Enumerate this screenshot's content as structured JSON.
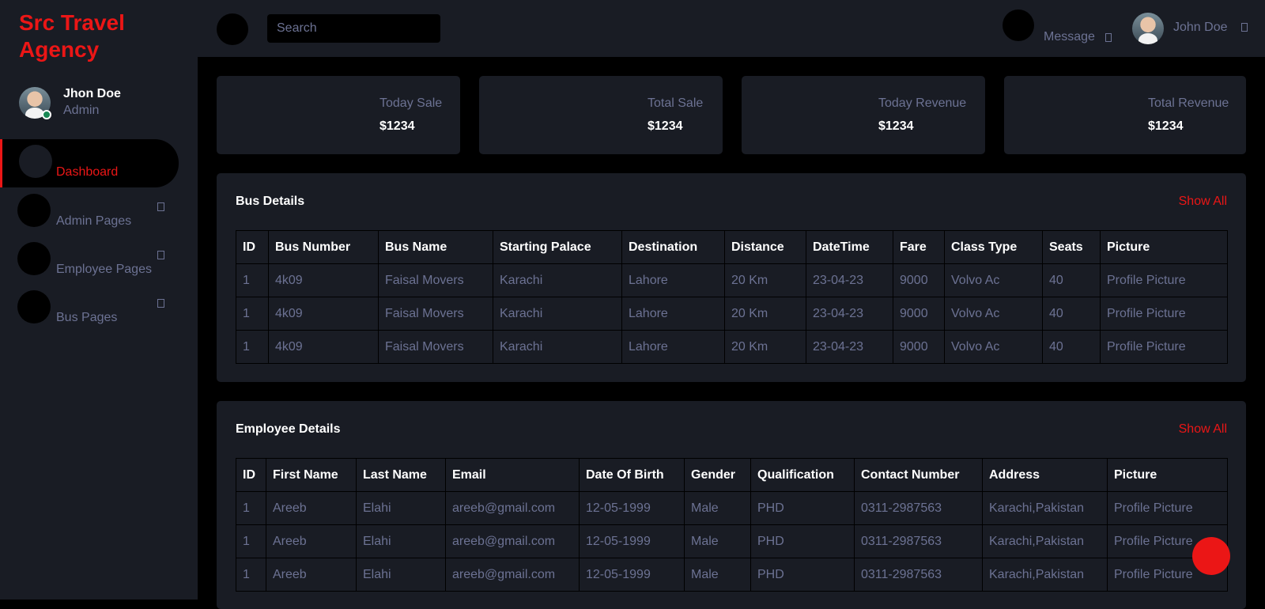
{
  "brand": "Src Travel Agency",
  "sidebar": {
    "user_name": "Jhon Doe",
    "user_role": "Admin",
    "items": [
      {
        "label": "Dashboard"
      },
      {
        "label": "Admin Pages"
      },
      {
        "label": "Employee Pages"
      },
      {
        "label": "Bus Pages"
      }
    ]
  },
  "topbar": {
    "search_placeholder": "Search",
    "message_label": "Message",
    "user_name": "John Doe"
  },
  "stats": [
    {
      "label": "Today Sale",
      "value": "$1234"
    },
    {
      "label": "Total Sale",
      "value": "$1234"
    },
    {
      "label": "Today Revenue",
      "value": "$1234"
    },
    {
      "label": "Total Revenue",
      "value": "$1234"
    }
  ],
  "bus": {
    "title": "Bus Details",
    "show_all": "Show All",
    "headers": [
      "ID",
      "Bus Number",
      "Bus Name",
      "Starting Palace",
      "Destination",
      "Distance",
      "DateTime",
      "Fare",
      "Class Type",
      "Seats",
      "Picture"
    ],
    "rows": [
      [
        "1",
        "4k09",
        "Faisal Movers",
        "Karachi",
        "Lahore",
        "20 Km",
        "23-04-23",
        "9000",
        "Volvo Ac",
        "40",
        "Profile Picture"
      ],
      [
        "1",
        "4k09",
        "Faisal Movers",
        "Karachi",
        "Lahore",
        "20 Km",
        "23-04-23",
        "9000",
        "Volvo Ac",
        "40",
        "Profile Picture"
      ],
      [
        "1",
        "4k09",
        "Faisal Movers",
        "Karachi",
        "Lahore",
        "20 Km",
        "23-04-23",
        "9000",
        "Volvo Ac",
        "40",
        "Profile Picture"
      ]
    ]
  },
  "employee": {
    "title": "Employee Details",
    "show_all": "Show All",
    "headers": [
      "ID",
      "First Name",
      "Last Name",
      "Email",
      "Date Of Birth",
      "Gender",
      "Qualification",
      "Contact Number",
      "Address",
      "Picture"
    ],
    "rows": [
      [
        "1",
        "Areeb",
        "Elahi",
        "areeb@gmail.com",
        "12-05-1999",
        "Male",
        "PHD",
        "0311-2987563",
        "Karachi,Pakistan",
        "Profile Picture"
      ],
      [
        "1",
        "Areeb",
        "Elahi",
        "areeb@gmail.com",
        "12-05-1999",
        "Male",
        "PHD",
        "0311-2987563",
        "Karachi,Pakistan",
        "Profile Picture"
      ],
      [
        "1",
        "Areeb",
        "Elahi",
        "areeb@gmail.com",
        "12-05-1999",
        "Male",
        "PHD",
        "0311-2987563",
        "Karachi,Pakistan",
        "Profile Picture"
      ]
    ]
  },
  "colors": {
    "accent": "#eb1616",
    "panel": "#191c24",
    "muted_text": "#6c7293",
    "background": "#000000"
  }
}
